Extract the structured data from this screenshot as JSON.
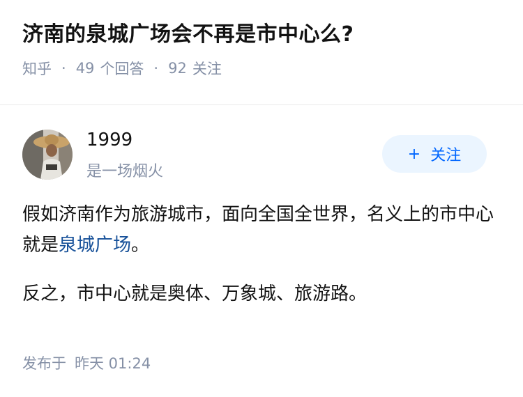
{
  "question": {
    "title": "济南的泉城广场会不再是市中心么?",
    "source": "知乎",
    "answer_count": "49",
    "answer_label": "个回答",
    "follower_count": "92",
    "follower_label": "关注"
  },
  "author": {
    "name": "1999",
    "bio": "是一场烟火",
    "follow_plus": "+",
    "follow_label": "关注"
  },
  "answer": {
    "p1_before_link": "假如济南作为旅游城市，面向全国全世界，名义上的市中心就是",
    "p1_link": "泉城广场",
    "p1_after_link": "。",
    "p2": "反之，市中心就是奥体、万象城、旅游路。"
  },
  "publish": {
    "label": "发布于",
    "time": "昨天 01:24"
  },
  "colors": {
    "link": "#175199",
    "accent": "#0066ff",
    "button_bg": "#ebf5ff",
    "meta_gray": "#8590a6"
  }
}
